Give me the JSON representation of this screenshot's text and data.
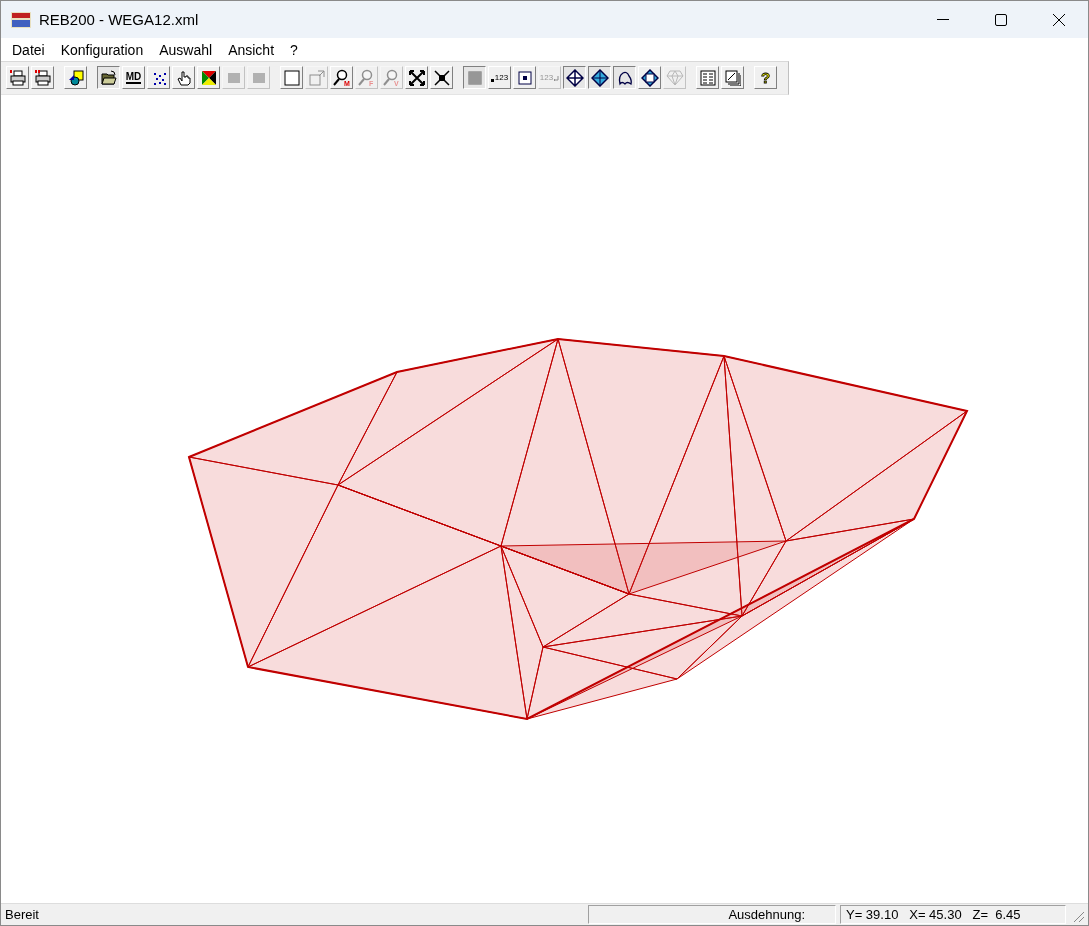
{
  "window": {
    "title": "REB200 - WEGA12.xml"
  },
  "menu": [
    "Datei",
    "Konfiguration",
    "Auswahl",
    "Ansicht",
    "?"
  ],
  "toolbar": [
    [
      {
        "kind": "printer",
        "pressed": false,
        "disabled": false
      },
      {
        "kind": "printer-double",
        "pressed": false,
        "disabled": false
      }
    ],
    [
      {
        "kind": "shapes",
        "pressed": false,
        "disabled": false
      }
    ],
    [
      {
        "kind": "folder",
        "pressed": true,
        "disabled": false
      },
      {
        "kind": "text",
        "label": "MD",
        "pressed": false,
        "disabled": false
      },
      {
        "kind": "dots",
        "pressed": false,
        "disabled": false
      },
      {
        "kind": "hand",
        "pressed": false,
        "disabled": false
      },
      {
        "kind": "triangles",
        "pressed": false,
        "disabled": false
      },
      {
        "kind": "block",
        "pressed": false,
        "disabled": true
      },
      {
        "kind": "block",
        "pressed": false,
        "disabled": true
      }
    ],
    [
      {
        "kind": "square",
        "pressed": false,
        "disabled": false
      },
      {
        "kind": "export",
        "pressed": false,
        "disabled": true
      },
      {
        "kind": "magnifier",
        "label": "M",
        "pressed": false,
        "disabled": false
      },
      {
        "kind": "magnifier",
        "label": "F",
        "pressed": false,
        "disabled": true
      },
      {
        "kind": "magnifier",
        "label": "V",
        "pressed": false,
        "disabled": true
      },
      {
        "kind": "expand",
        "pressed": false,
        "disabled": false
      },
      {
        "kind": "collapse",
        "pressed": false,
        "disabled": false
      }
    ],
    [
      {
        "kind": "grid",
        "pressed": true,
        "disabled": false
      },
      {
        "kind": "number",
        "label": "123",
        "pressed": false,
        "disabled": false
      },
      {
        "kind": "point",
        "pressed": false,
        "disabled": false
      },
      {
        "kind": "number-undo",
        "label": "123",
        "pressed": false,
        "disabled": true
      },
      {
        "kind": "diamond",
        "pressed": true,
        "disabled": false
      },
      {
        "kind": "diamond-filled",
        "pressed": true,
        "disabled": false
      },
      {
        "kind": "outline",
        "pressed": true,
        "disabled": false
      },
      {
        "kind": "diamond-boxed",
        "pressed": false,
        "disabled": false
      },
      {
        "kind": "crystal",
        "pressed": false,
        "disabled": true
      }
    ],
    [
      {
        "kind": "lines",
        "pressed": false,
        "disabled": false
      },
      {
        "kind": "frame",
        "pressed": false,
        "disabled": false
      }
    ],
    [
      {
        "kind": "help",
        "label": "?",
        "pressed": false,
        "disabled": false
      }
    ]
  ],
  "status_bar": {
    "message": "Bereit",
    "label": "Ausdehnung:",
    "extent": "Y= 39.10   X= 45.30   Z=  6.45"
  }
}
